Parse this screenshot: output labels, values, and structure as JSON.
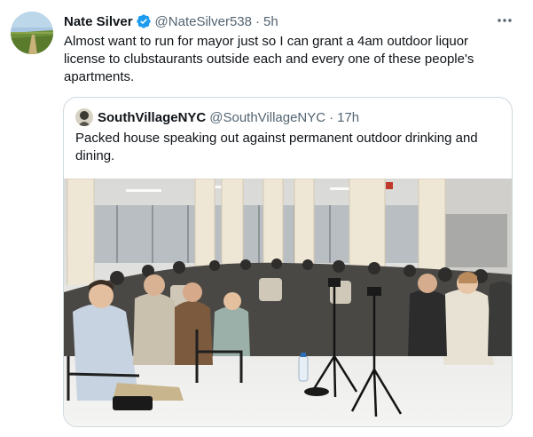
{
  "tweet": {
    "author_name": "Nate Silver",
    "author_handle": "@NateSilver538",
    "separator": "·",
    "time": "5h",
    "text": "Almost want to run for mayor just so I can grant a 4am outdoor liquor license to clubstaurants outside each and every one of these people's apartments.",
    "verified": true,
    "icons": {
      "verified": "verified-badge-icon",
      "more": "more-options-icon"
    }
  },
  "quoted": {
    "author_name": "SouthVillageNYC",
    "author_handle": "@SouthVillageNYC",
    "separator": "·",
    "time": "17h",
    "text": "Packed house speaking out against permanent outdoor drinking and dining."
  },
  "colors": {
    "accent": "#1d9bf0",
    "text_primary": "#0f1419",
    "text_secondary": "#536471",
    "border": "#cfd9de"
  }
}
